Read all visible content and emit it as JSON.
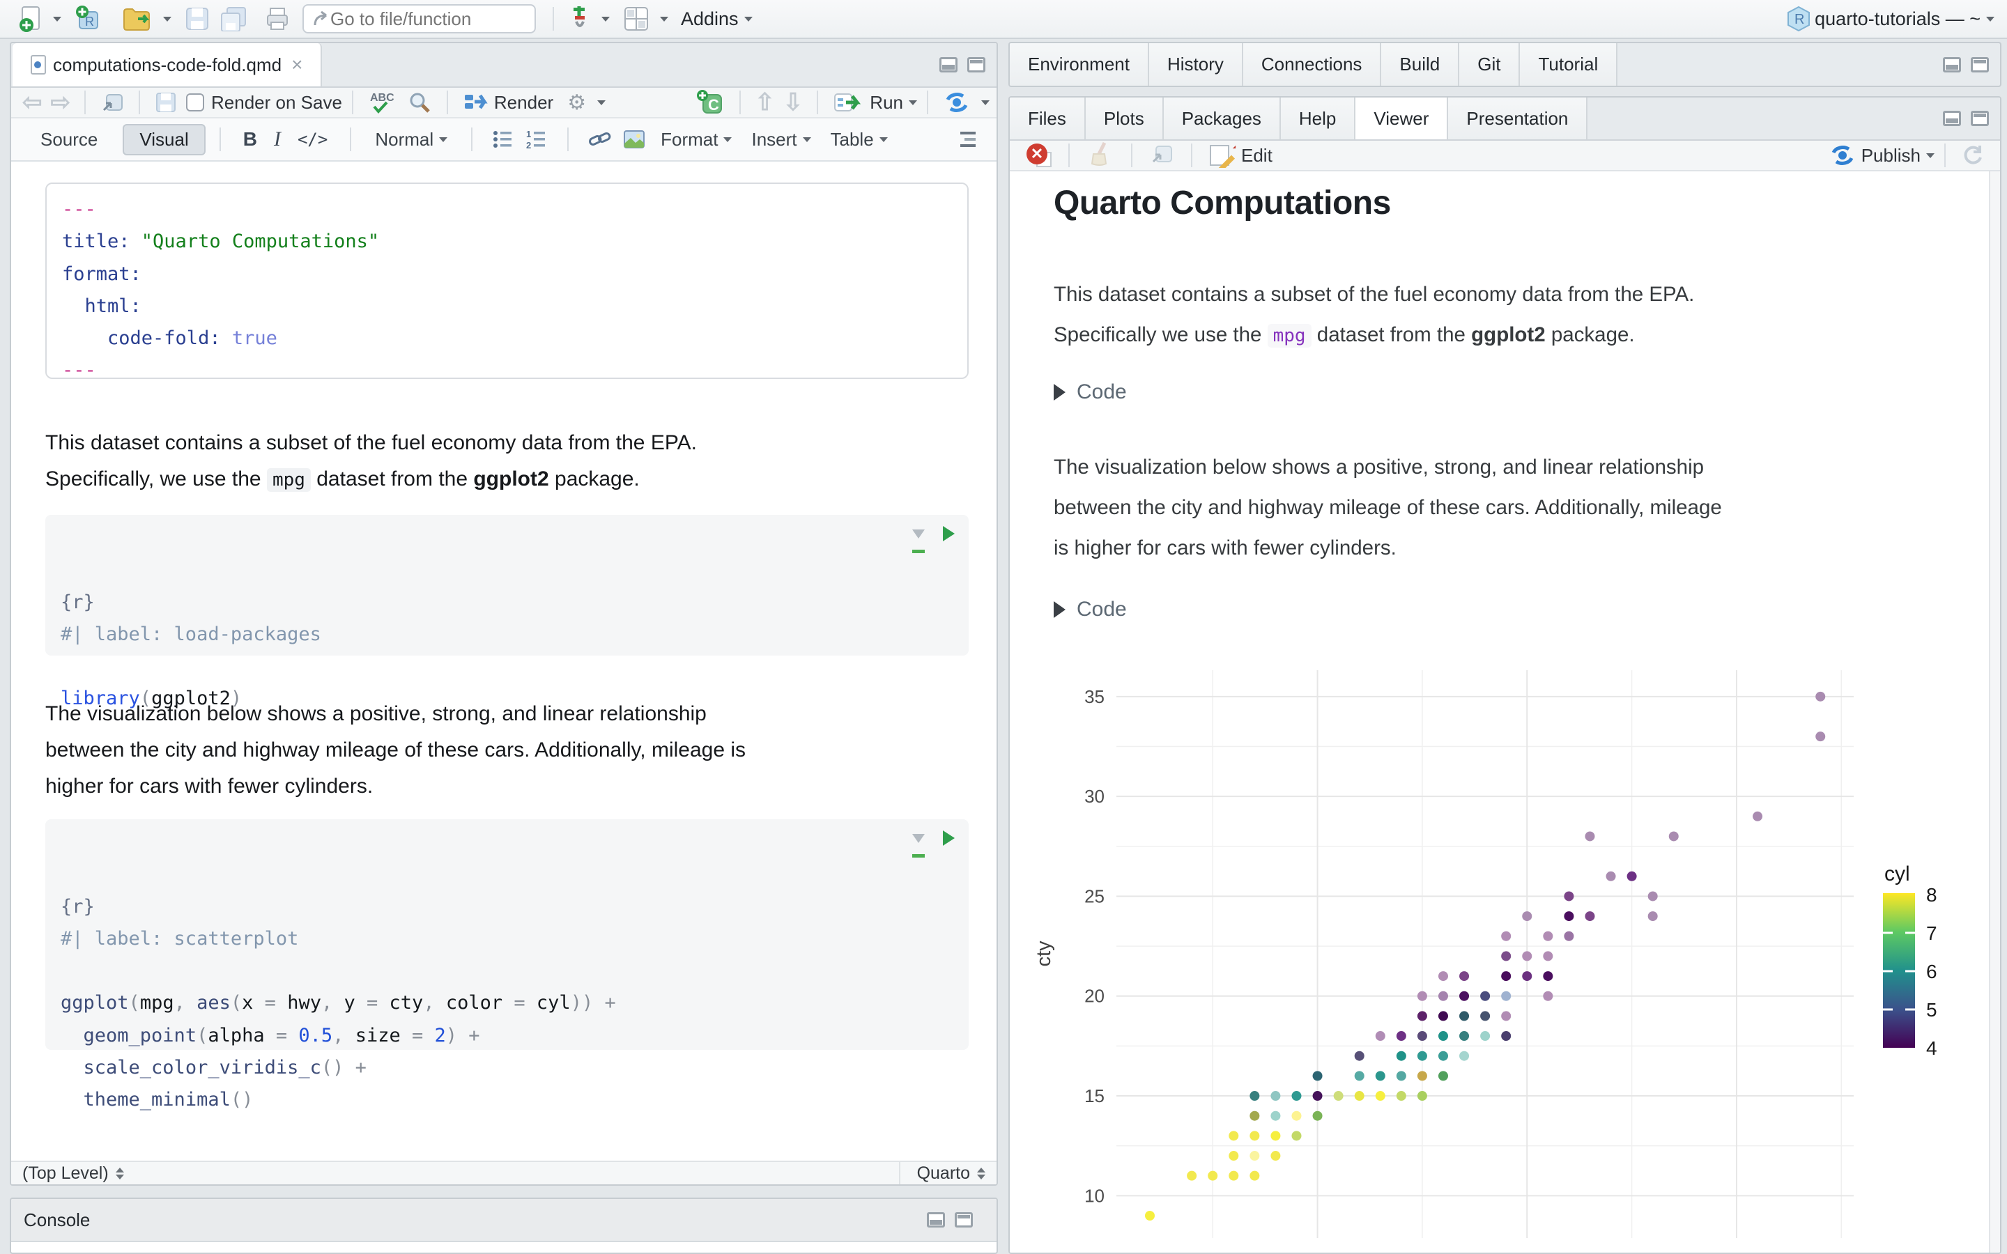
{
  "window": {
    "goto_placeholder": "Go to file/function",
    "addins_label": "Addins",
    "project_label": "quarto-tutorials — ~"
  },
  "editor": {
    "tab_title": "computations-code-fold.qmd",
    "toolbar": {
      "render_on_save": "Render on Save",
      "render": "Render",
      "run": "Run"
    },
    "format_toolbar": {
      "source": "Source",
      "visual": "Visual",
      "bold": "B",
      "italic": "I",
      "code": "</>",
      "paragraph_style": "Normal",
      "format": "Format",
      "insert": "Insert",
      "table": "Table"
    },
    "yaml_lines": [
      [
        [
          "---",
          "yd"
        ]
      ],
      [
        [
          "title: ",
          "yk"
        ],
        [
          "\"Quarto Computations\"",
          "ys"
        ]
      ],
      [
        [
          "format:",
          "yk"
        ]
      ],
      [
        [
          "  html:",
          "yk"
        ]
      ],
      [
        [
          "    code-fold: ",
          "yk"
        ],
        [
          "true",
          "yb"
        ]
      ],
      [
        [
          "---",
          "yd"
        ]
      ]
    ],
    "para1_lines": [
      [
        [
          "This dataset contains a subset of the fuel economy data from the EPA.",
          "pr"
        ]
      ],
      [
        [
          "Specifically, we use the ",
          "pr"
        ],
        [
          "mpg",
          "chip"
        ],
        [
          " dataset from the ",
          "pr"
        ],
        [
          "ggplot2",
          "bold"
        ],
        [
          " package.",
          "pr"
        ]
      ]
    ],
    "chunk1_lines": [
      [
        [
          "{r}",
          "rb"
        ]
      ],
      [
        [
          "#| label: load-packages",
          "cm"
        ]
      ],
      [
        [
          " ",
          "pl"
        ]
      ],
      [
        [
          "library",
          "kw"
        ],
        [
          "(",
          "pu"
        ],
        [
          "ggplot2",
          "pl"
        ],
        [
          ")",
          "pu"
        ]
      ]
    ],
    "para2_lines": [
      [
        [
          "The visualization below shows a positive, strong, and linear relationship",
          "pr"
        ]
      ],
      [
        [
          "between the city and highway mileage of these cars. Additionally, mileage is",
          "pr"
        ]
      ],
      [
        [
          "higher for cars with fewer cylinders.",
          "pr"
        ]
      ]
    ],
    "chunk2_lines": [
      [
        [
          "{r}",
          "rb"
        ]
      ],
      [
        [
          "#| label: scatterplot",
          "cm"
        ]
      ],
      [
        [
          " ",
          "pl"
        ]
      ],
      [
        [
          "ggplot",
          "fn"
        ],
        [
          "(",
          "pu"
        ],
        [
          "mpg",
          "pl"
        ],
        [
          ", ",
          "pu"
        ],
        [
          "aes",
          "fn"
        ],
        [
          "(",
          "pu"
        ],
        [
          "x",
          "pl"
        ],
        [
          " = ",
          "pu"
        ],
        [
          "hwy",
          "pl"
        ],
        [
          ", ",
          "pu"
        ],
        [
          "y",
          "pl"
        ],
        [
          " = ",
          "pu"
        ],
        [
          "cty",
          "pl"
        ],
        [
          ", ",
          "pu"
        ],
        [
          "color",
          "pl"
        ],
        [
          " = ",
          "pu"
        ],
        [
          "cyl",
          "pl"
        ],
        [
          "))",
          "pu"
        ],
        [
          " +",
          "pu"
        ]
      ],
      [
        [
          "  ",
          "pl"
        ],
        [
          "geom_point",
          "fn"
        ],
        [
          "(",
          "pu"
        ],
        [
          "alpha",
          "pl"
        ],
        [
          " = ",
          "pu"
        ],
        [
          "0.5",
          "nu"
        ],
        [
          ", ",
          "pu"
        ],
        [
          "size",
          "pl"
        ],
        [
          " = ",
          "pu"
        ],
        [
          "2",
          "nu"
        ],
        [
          ")",
          "pu"
        ],
        [
          " +",
          "pu"
        ]
      ],
      [
        [
          "  ",
          "pl"
        ],
        [
          "scale_color_viridis_c",
          "fn"
        ],
        [
          "()",
          "pu"
        ],
        [
          " +",
          "pu"
        ]
      ],
      [
        [
          "  ",
          "pl"
        ],
        [
          "theme_minimal",
          "fn"
        ],
        [
          "()",
          "pu"
        ]
      ]
    ],
    "status_left": "(Top Level)",
    "status_right": "Quarto"
  },
  "console": {
    "title": "Console"
  },
  "right_top_tabs": [
    "Environment",
    "History",
    "Connections",
    "Build",
    "Git",
    "Tutorial"
  ],
  "right_tabs": [
    "Files",
    "Plots",
    "Packages",
    "Help",
    "Viewer",
    "Presentation"
  ],
  "right_tabs_active": "Viewer",
  "viewer": {
    "edit_label": "Edit",
    "publish_label": "Publish",
    "title": "Quarto Computations",
    "para1_lines": [
      [
        [
          "This dataset contains a subset of the fuel economy data from the EPA.",
          "pr"
        ]
      ],
      [
        [
          "Specifically we use the ",
          "pr"
        ],
        [
          "mpg",
          "vchip"
        ],
        [
          " dataset from the ",
          "pr"
        ],
        [
          "ggplot2",
          "bold"
        ],
        [
          " package.",
          "pr"
        ]
      ]
    ],
    "code_button": "Code",
    "para2_lines": [
      [
        [
          "The visualization below shows a positive, strong, and linear relationship",
          "pr"
        ]
      ],
      [
        [
          "between the city and highway mileage of these cars. Additionally, mileage",
          "pr"
        ]
      ],
      [
        [
          "is higher for cars with fewer cylinders.",
          "pr"
        ]
      ]
    ]
  },
  "chart_data": {
    "type": "scatter",
    "x_var": "hwy",
    "y_var": "cty",
    "color_var": "cyl",
    "xlabel": "",
    "ylabel": "cty",
    "x_range": [
      10.4,
      45.6
    ],
    "y_range": [
      7.9,
      36.4
    ],
    "x_gridlines_major": [
      20,
      30,
      40
    ],
    "x_gridlines_minor": [
      15,
      25,
      35,
      45
    ],
    "y_ticks": [
      10,
      15,
      20,
      25,
      30,
      35
    ],
    "y_gridlines_minor": [
      12.5,
      17.5,
      22.5,
      27.5,
      32.5
    ],
    "point_alpha": 0.5,
    "point_size": 2,
    "legend": {
      "title": "cyl",
      "ticks": [
        8,
        7,
        6,
        5,
        4
      ],
      "viridis_stops": [
        "#FDE725",
        "#5EC962",
        "#21918C",
        "#3B528B",
        "#440154"
      ]
    },
    "points": [
      [
        44,
        35,
        "#a98bb0"
      ],
      [
        44,
        33,
        "#a98bb0"
      ],
      [
        41,
        29,
        "#a98bb0"
      ],
      [
        33,
        28,
        "#a98bb0"
      ],
      [
        37,
        28,
        "#a98bb0"
      ],
      [
        34,
        26,
        "#a98bb0"
      ],
      [
        35,
        26,
        "#6d3084"
      ],
      [
        32,
        25,
        "#7b4488"
      ],
      [
        36,
        25,
        "#a98bb0"
      ],
      [
        30,
        24,
        "#a98bb0"
      ],
      [
        32,
        24,
        "#4a0e5e"
      ],
      [
        33,
        24,
        "#7b4488"
      ],
      [
        36,
        24,
        "#a98bb0"
      ],
      [
        29,
        23,
        "#b18cb4"
      ],
      [
        31,
        23,
        "#b18cb4"
      ],
      [
        32,
        23,
        "#9a74a4"
      ],
      [
        29,
        22,
        "#7b4d8a"
      ],
      [
        30,
        22,
        "#b18cb4"
      ],
      [
        31,
        22,
        "#b18cb4"
      ],
      [
        26,
        21,
        "#b18cb4"
      ],
      [
        27,
        21,
        "#7b4488"
      ],
      [
        29,
        21,
        "#490d5c"
      ],
      [
        30,
        21,
        "#6b3080"
      ],
      [
        31,
        21,
        "#4a0e5e"
      ],
      [
        25,
        20,
        "#b18cb4"
      ],
      [
        26,
        20,
        "#a583ae"
      ],
      [
        27,
        20,
        "#4c1060"
      ],
      [
        28,
        20,
        "#4a4d7e"
      ],
      [
        29,
        20,
        "#9fb2d0"
      ],
      [
        31,
        20,
        "#b18cb4"
      ],
      [
        25,
        19,
        "#5c2169"
      ],
      [
        26,
        19,
        "#400a52"
      ],
      [
        27,
        19,
        "#2f5a68"
      ],
      [
        28,
        19,
        "#46536e"
      ],
      [
        29,
        19,
        "#b18cb4"
      ],
      [
        23,
        18,
        "#b08cb5"
      ],
      [
        24,
        18,
        "#6d3084"
      ],
      [
        25,
        18,
        "#5a4a78"
      ],
      [
        26,
        18,
        "#1f9288"
      ],
      [
        27,
        18,
        "#37807f"
      ],
      [
        28,
        18,
        "#9dd3cb"
      ],
      [
        29,
        18,
        "#4a3f6e"
      ],
      [
        22,
        17,
        "#575077"
      ],
      [
        24,
        17,
        "#1f9288"
      ],
      [
        25,
        17,
        "#2f9a92"
      ],
      [
        26,
        17,
        "#3b9e97"
      ],
      [
        27,
        17,
        "#a5d5cf"
      ],
      [
        20,
        16,
        "#2c6472"
      ],
      [
        22,
        16,
        "#56aaa4"
      ],
      [
        23,
        16,
        "#2b968d"
      ],
      [
        24,
        16,
        "#54a8a2"
      ],
      [
        25,
        16,
        "#c7a84a"
      ],
      [
        26,
        16,
        "#51a05c"
      ],
      [
        17,
        15,
        "#37807f"
      ],
      [
        18,
        15,
        "#8fc6c2"
      ],
      [
        19,
        15,
        "#2f9a92"
      ],
      [
        20,
        15,
        "#45125a"
      ],
      [
        21,
        15,
        "#cedd7a"
      ],
      [
        22,
        15,
        "#e8e544"
      ],
      [
        23,
        15,
        "#f6ef3f"
      ],
      [
        24,
        15,
        "#c3d967"
      ],
      [
        25,
        15,
        "#a9cf5f"
      ],
      [
        17,
        14,
        "#a3a94e"
      ],
      [
        18,
        14,
        "#9dd3cb"
      ],
      [
        19,
        14,
        "#fdf392"
      ],
      [
        20,
        14,
        "#7ab356"
      ],
      [
        16,
        13,
        "#f2e94e"
      ],
      [
        17,
        13,
        "#f2e94e"
      ],
      [
        18,
        13,
        "#f6ef3f"
      ],
      [
        19,
        13,
        "#c3d967"
      ],
      [
        16,
        12,
        "#f2e94e"
      ],
      [
        17,
        12,
        "#faf4a0"
      ],
      [
        18,
        12,
        "#f2e94e"
      ],
      [
        14,
        11,
        "#f2e94e"
      ],
      [
        15,
        11,
        "#f2e94e"
      ],
      [
        16,
        11,
        "#f2e94e"
      ],
      [
        17,
        11,
        "#f2e94e"
      ],
      [
        12,
        9,
        "#f6ef3f"
      ]
    ]
  }
}
